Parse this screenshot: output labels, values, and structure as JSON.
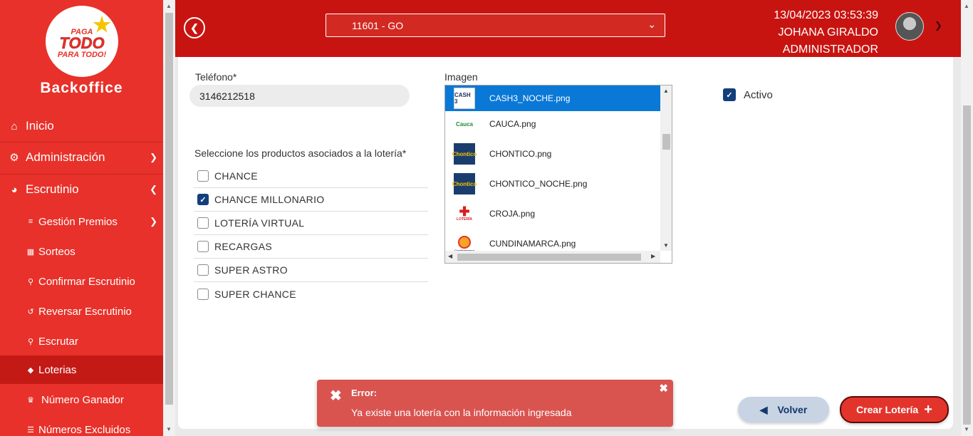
{
  "sidebar": {
    "logo": {
      "line1": "PAGA",
      "line2": "TODO",
      "line3": "PARA TODO!"
    },
    "brand": "Backoffice",
    "items": [
      {
        "label": "Inicio",
        "icon": "home-icon"
      },
      {
        "label": "Administración",
        "icon": "gear-icon"
      },
      {
        "label": "Escrutinio",
        "icon": "pie-chart-icon"
      }
    ],
    "subitems": [
      {
        "label": "Gestión Premios",
        "icon": "sliders-icon"
      },
      {
        "label": "Sorteos",
        "icon": "calendar-icon"
      },
      {
        "label": "Confirmar Escrutinio",
        "icon": "search-icon"
      },
      {
        "label": "Reversar Escrutinio",
        "icon": "undo-icon"
      },
      {
        "label": "Escrutar",
        "icon": "search-icon"
      },
      {
        "label": "Loterias",
        "icon": "ticket-icon"
      },
      {
        "label": "Número Ganador",
        "icon": "trophy-icon"
      },
      {
        "label": "Números Excluidos",
        "icon": "list-icon"
      }
    ]
  },
  "header": {
    "office_select": "11601 - GO",
    "datetime": "13/04/2023 03:53:39",
    "user_name": "JOHANA GIRALDO",
    "user_role": "ADMINISTRADOR"
  },
  "form": {
    "phone_label": "Teléfono*",
    "phone_value": "3146212518",
    "image_label": "Imagen",
    "products_label": "Seleccione los productos asociados a la lotería*",
    "products": [
      {
        "label": "CHANCE",
        "checked": false
      },
      {
        "label": "CHANCE MILLONARIO",
        "checked": true
      },
      {
        "label": "LOTERÍA VIRTUAL",
        "checked": false
      },
      {
        "label": "RECARGAS",
        "checked": false
      },
      {
        "label": "SUPER ASTRO",
        "checked": false
      },
      {
        "label": "SUPER CHANCE",
        "checked": false
      }
    ],
    "images": [
      {
        "file": "CASH3_NOCHE.png",
        "thumb_text": "CASH 3",
        "selected": true
      },
      {
        "file": "CAUCA.png",
        "thumb_text": "Cauca",
        "selected": false
      },
      {
        "file": "CHONTICO.png",
        "thumb_text": "Chontico",
        "selected": false
      },
      {
        "file": "CHONTICO_NOCHE.png",
        "thumb_text": "Chontico",
        "selected": false
      },
      {
        "file": "CROJA.png",
        "thumb_text": "LOTERÍA",
        "selected": false
      },
      {
        "file": "CUNDINAMARCA.png",
        "thumb_text": "Cundinamarca",
        "selected": false
      }
    ],
    "activo_label": "Activo",
    "activo_checked": true
  },
  "toast": {
    "title": "Error:",
    "message": "Ya existe una lotería con la información ingresada"
  },
  "buttons": {
    "volver": "Volver",
    "crear": "Crear Lotería"
  },
  "colors": {
    "sidebar": "#e8312a",
    "header": "#c81411",
    "accent_blue": "#123f7c",
    "error": "#d9534f"
  }
}
